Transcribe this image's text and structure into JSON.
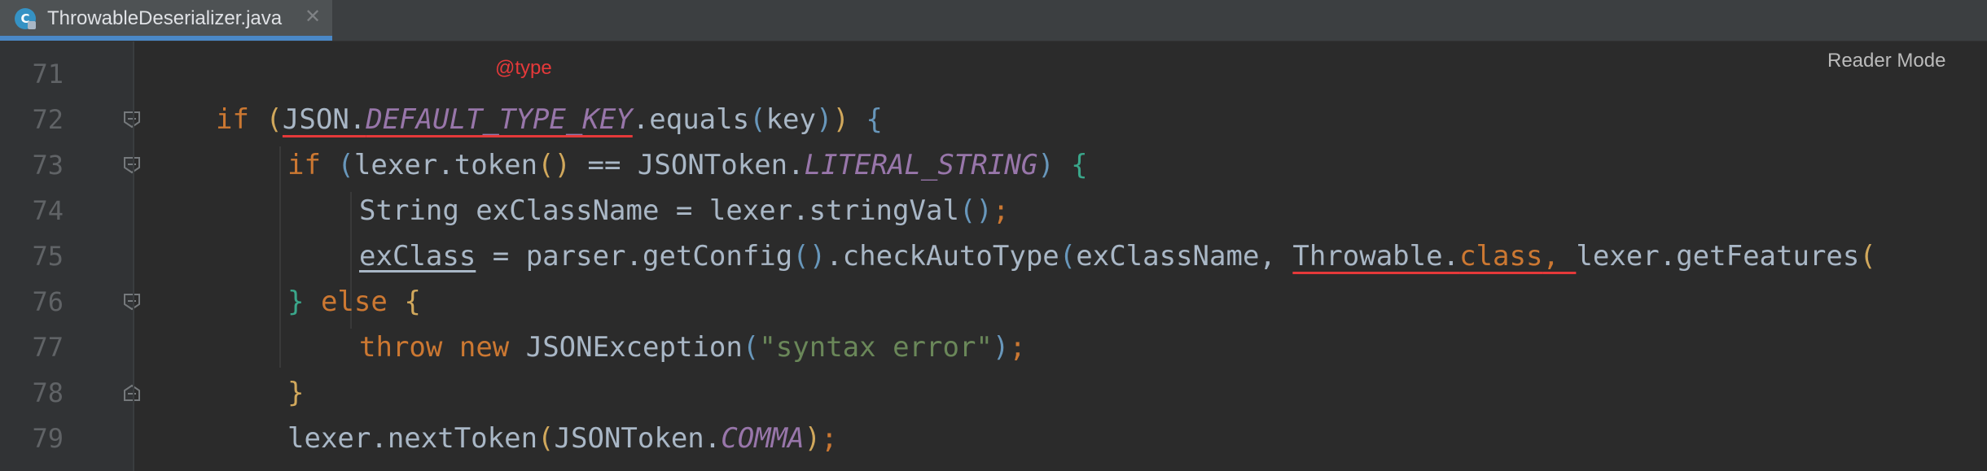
{
  "tab": {
    "file_name": "ThrowableDeserializer.java",
    "icon_letter": "C",
    "close_glyph": "✕"
  },
  "editor": {
    "reader_mode": "Reader Mode",
    "inlay_hint": "@type",
    "lines": [
      {
        "num": "71"
      },
      {
        "num": "72"
      },
      {
        "num": "73"
      },
      {
        "num": "74"
      },
      {
        "num": "75"
      },
      {
        "num": "76"
      },
      {
        "num": "77"
      },
      {
        "num": "78"
      },
      {
        "num": "79"
      }
    ],
    "code": {
      "l72": {
        "kw": "if",
        "a": " (",
        "b": "JSON.",
        "c": "DEFAULT_TYPE_KEY",
        "d": ".equals",
        "e": "(",
        "f": "key",
        "g": ")",
        "h": ")",
        "i": " {"
      },
      "l73": {
        "kw": "if",
        "a": " (",
        "b": "lexer.token",
        "c": "()",
        "d": " == JSONToken.",
        "e": "LITERAL_STRING",
        "f": ")",
        "g": " {"
      },
      "l74": {
        "a": "String exClassName = lexer.stringVal",
        "b": "()",
        "c": ";"
      },
      "l75": {
        "a": "exClass",
        "b": " = parser.getConfig",
        "c": "()",
        "d": ".checkAutoType",
        "e": "(",
        "f": "exClassName, ",
        "g": "Throwable.",
        "h": "class",
        "i": ", ",
        "j": "lexer.getFeatures",
        "k": "("
      },
      "l76": {
        "a": "}",
        "b": " else ",
        "c": "{"
      },
      "l77": {
        "a": "throw",
        "b": " ",
        "c": "new",
        "d": " JSONException",
        "e": "(",
        "f": "\"syntax error\"",
        "g": ")",
        "h": ";"
      },
      "l78": {
        "a": "}"
      },
      "l79": {
        "a": "lexer.nextToken",
        "b": "(",
        "c": "JSONToken.",
        "d": "COMMA",
        "e": ")",
        "f": ";"
      }
    }
  },
  "colors": {
    "background": "#2b2b2b",
    "keyword": "#cc7832",
    "constant": "#9876aa",
    "string": "#6a8759",
    "error_underline": "#e5393a"
  }
}
